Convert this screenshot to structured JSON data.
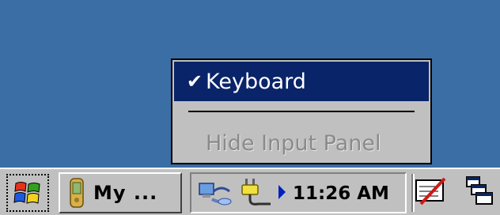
{
  "menu": {
    "items": [
      {
        "label": "Keyboard",
        "checked": true,
        "selected": true,
        "enabled": true
      },
      {
        "label": "Hide Input Panel",
        "checked": false,
        "selected": false,
        "enabled": false
      }
    ]
  },
  "taskbar": {
    "start_icon": "windows-flag-icon",
    "task_button": {
      "label": "My ...",
      "icon": "pda-device-icon"
    },
    "tray": {
      "icons": [
        "network-connection-icon",
        "power-plug-icon"
      ],
      "time": "11:26 AM"
    },
    "right_icons": [
      "input-panel-pen-icon",
      "cascade-windows-icon"
    ]
  },
  "colors": {
    "desktop": "#3a6ea5",
    "menu_bg": "#c0c0c0",
    "highlight": "#0a246a",
    "disabled_text": "#8a8a8a"
  }
}
